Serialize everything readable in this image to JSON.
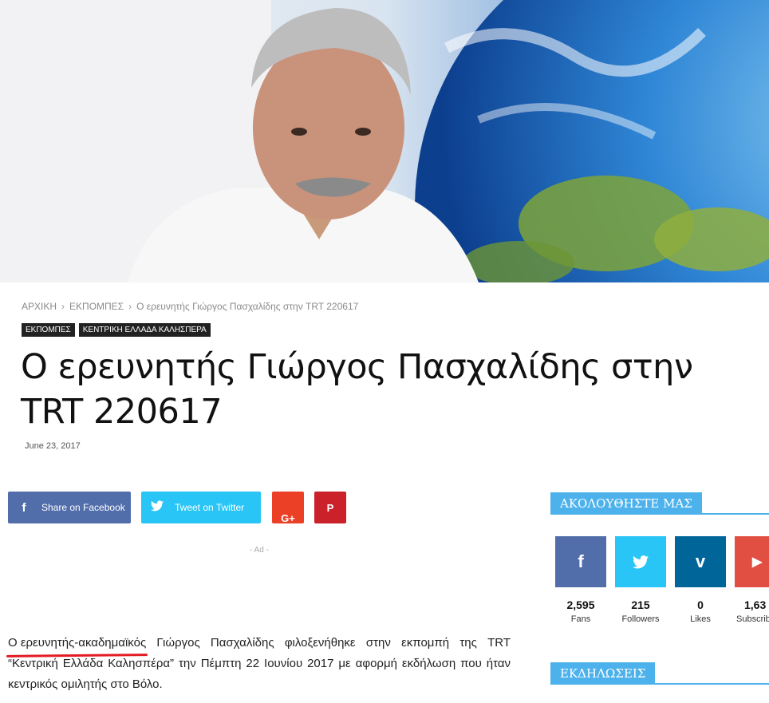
{
  "breadcrumb": {
    "home": "ΑΡΧΙΚΗ",
    "section": "ΕΚΠΟΜΠΕΣ",
    "current": "Ο ερευνητής Γιώργος Πασχαλίδης στην TRT 220617",
    "separator": "›"
  },
  "categories": [
    "ΕΚΠΟΜΠΕΣ",
    "ΚΕΝΤΡΙΚΗ ΕΛΛΑΔΑ ΚΑΛΗΣΠΕΡΑ"
  ],
  "article": {
    "title": "Ο ερευνητής Γιώργος Πασχαλίδης στην TRT 220617",
    "date": "June 23, 2017",
    "ad_label": "- Ad -",
    "body_highlight": "Ο ερευνητής-ακαδημαϊκός",
    "body_rest": " Γιώργος Πασχαλίδης φιλοξενήθηκε στην εκπομπή της TRT “Κεντρική Ελλάδα Καλησπέρα” την Πέμπτη 22 Ιουνίου 2017 με αφορμή εκδήλωση που ήταν κεντρικός ομιλητής στο Βόλο."
  },
  "share": {
    "facebook": {
      "label": "Share on Facebook",
      "icon": "f"
    },
    "twitter": {
      "label": "Tweet on Twitter",
      "icon": "🐦"
    },
    "googleplus": {
      "icon": "G+"
    },
    "pinterest": {
      "icon": "P"
    }
  },
  "sidebar": {
    "follow_title": "ΑΚΟΛΟΥΘΗΣΤΕ ΜΑΣ",
    "events_title": "ΕΚΔΗΛΩΣΕΙΣ",
    "social": [
      {
        "icon": "f",
        "count": "2,595",
        "name": "Fans"
      },
      {
        "icon": "🐦",
        "count": "215",
        "name": "Followers"
      },
      {
        "icon": "v",
        "count": "0",
        "name": "Likes"
      },
      {
        "icon": "▶",
        "count": "1,63",
        "name": "Subscrib"
      }
    ]
  },
  "colors": {
    "accent": "#4db2ec",
    "facebook": "#516eab",
    "twitter": "#29c5f6",
    "googleplus": "#eb4026",
    "pinterest": "#ca212a",
    "vimeo": "#006599",
    "youtube": "#e14e42"
  }
}
